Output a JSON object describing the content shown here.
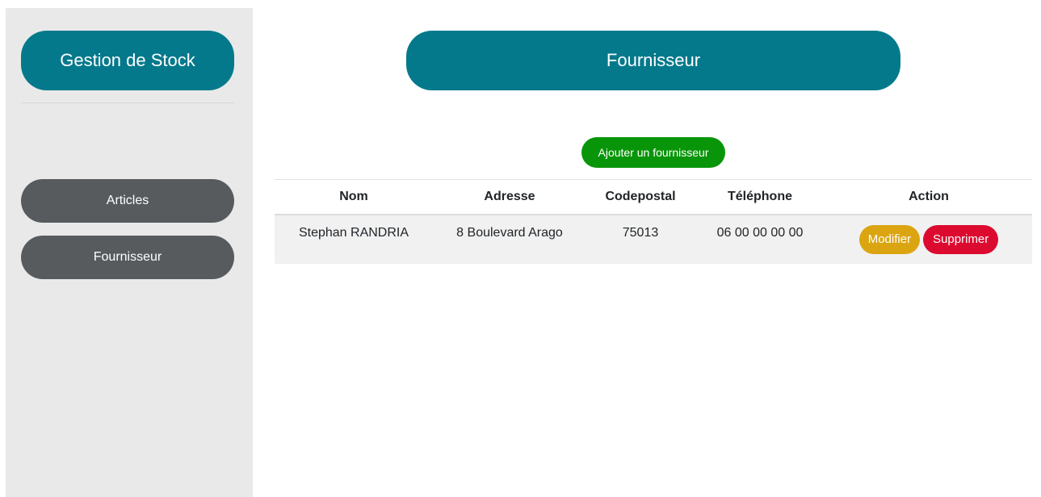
{
  "sidebar": {
    "brand": "Gestion de Stock",
    "items": [
      {
        "label": "Articles"
      },
      {
        "label": "Fournisseur"
      }
    ]
  },
  "main": {
    "title": "Fournisseur",
    "add_button": "Ajouter un fournisseur",
    "table": {
      "columns": [
        "Nom",
        "Adresse",
        "Codepostal",
        "Téléphone",
        "Action"
      ],
      "rows": [
        {
          "nom": "Stephan RANDRIA",
          "adresse": "8 Boulevard Arago",
          "codepostal": "75013",
          "telephone": "06 00 00 00 00",
          "actions": {
            "edit": "Modifier",
            "delete": "Supprimer"
          }
        }
      ]
    }
  },
  "colors": {
    "primary": "#04798c",
    "nav": "#575b5e",
    "success": "#099509",
    "warning": "#dba512",
    "danger": "#dc0a2f",
    "sidebar_bg": "#e9e9e9"
  }
}
